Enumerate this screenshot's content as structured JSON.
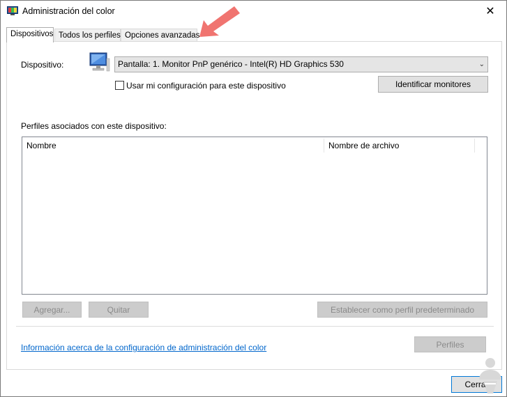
{
  "window": {
    "title": "Administración del color",
    "close_glyph": "✕"
  },
  "tabs": [
    {
      "label": "Dispositivos",
      "active": true
    },
    {
      "label": "Todos los perfiles",
      "active": false
    },
    {
      "label": "Opciones avanzadas",
      "active": false
    }
  ],
  "device": {
    "label": "Dispositivo:",
    "selected": "Pantalla: 1. Monitor PnP genérico - Intel(R) HD Graphics 530",
    "checkbox_label": "Usar mi configuración para este dispositivo",
    "checked": false,
    "identify_button": "Identificar monitores"
  },
  "profiles": {
    "label": "Perfiles asociados con este dispositivo:",
    "columns": [
      "Nombre",
      "Nombre de archivo"
    ],
    "rows": []
  },
  "buttons": {
    "add": "Agregar...",
    "remove": "Quitar",
    "set_default": "Establecer como perfil predeterminado",
    "profiles": "Perfiles",
    "close": "Cerrar"
  },
  "link": {
    "text": "Información acerca de la configuración de administración del color"
  },
  "colors": {
    "link": "#0066cc",
    "annotation_arrow": "#f07470",
    "watermark": "#d8d8d8"
  },
  "icons": [
    "color-management-app-icon",
    "monitor-icon",
    "chevron-down-icon",
    "close-icon",
    "annotation-arrow",
    "watermark-logo"
  ]
}
